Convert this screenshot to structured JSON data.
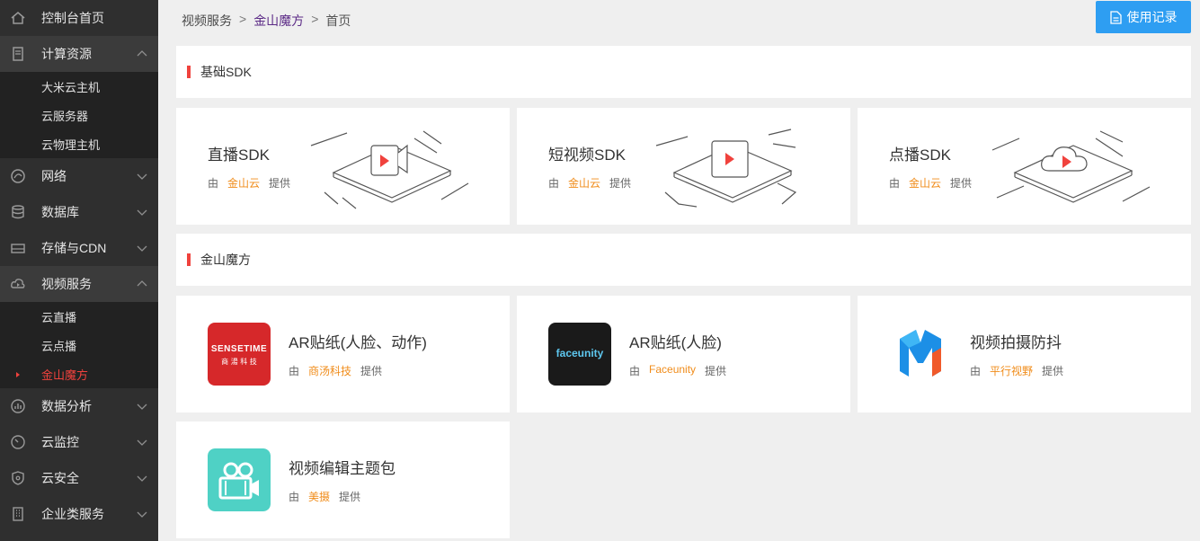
{
  "sidebar": {
    "home": "控制台首页",
    "compute": {
      "label": "计算资源",
      "items": [
        "大米云主机",
        "云服务器",
        "云物理主机"
      ]
    },
    "network": "网络",
    "database": "数据库",
    "storage": "存储与CDN",
    "video": {
      "label": "视频服务",
      "items": [
        "云直播",
        "云点播",
        "金山魔方"
      ]
    },
    "analytics": "数据分析",
    "monitor": "云监控",
    "security": "云安全",
    "enterprise": "企业类服务"
  },
  "breadcrumb": {
    "level1": "视频服务",
    "level2": "金山魔方",
    "level3": "首页",
    "sep": ">"
  },
  "usage_button": "使用记录",
  "section_sdk": {
    "title": "基础SDK"
  },
  "sdk_cards": [
    {
      "title": "直播SDK",
      "by": "由",
      "vendor": "金山云",
      "provides": "提供"
    },
    {
      "title": "短视频SDK",
      "by": "由",
      "vendor": "金山云",
      "provides": "提供"
    },
    {
      "title": "点播SDK",
      "by": "由",
      "vendor": "金山云",
      "provides": "提供"
    }
  ],
  "section_magic": {
    "title": "金山魔方"
  },
  "app_cards": [
    {
      "title": "AR贴纸(人脸、动作)",
      "by": "由",
      "vendor": "商汤科技",
      "provides": "提供",
      "logo_text": "SENSETIME",
      "logo_sub": "商 湯 科 技"
    },
    {
      "title": "AR贴纸(人脸)",
      "by": "由",
      "vendor": "Faceunity",
      "provides": "提供",
      "logo_text": "faceunity"
    },
    {
      "title": "视频拍摄防抖",
      "by": "由",
      "vendor": "平行视野",
      "provides": "提供"
    },
    {
      "title": "视频编辑主题包",
      "by": "由",
      "vendor": "美摄",
      "provides": "提供"
    }
  ],
  "colors": {
    "accent_red": "#f0423d",
    "vendor_orange": "#f08c1a",
    "button_blue": "#2e9ef2",
    "sidebar_bg": "#2f2f2f"
  }
}
